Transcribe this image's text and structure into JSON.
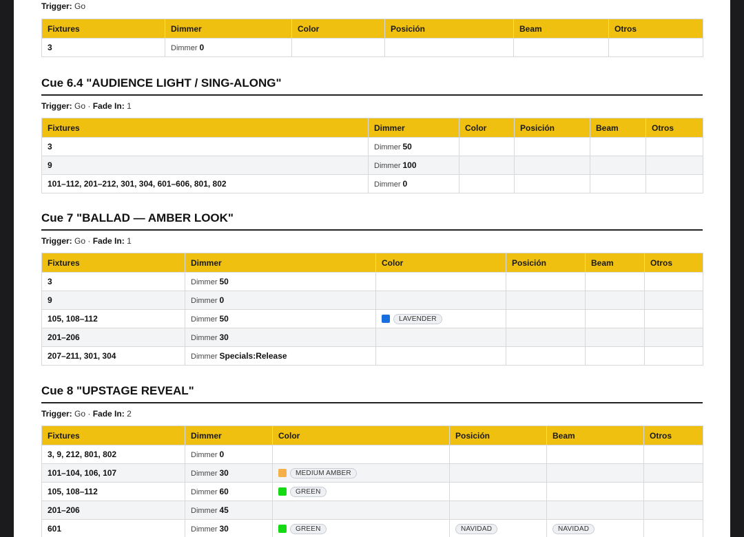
{
  "top": {
    "trigger_label": "Trigger:",
    "trigger_value": "Go",
    "headers": [
      "Fixtures",
      "Dimmer",
      "Color",
      "Posición",
      "Beam",
      "Otros"
    ],
    "rows": [
      {
        "fixtures": "3",
        "dimmer_label": "Dimmer",
        "dimmer_value": "0"
      }
    ]
  },
  "cues": [
    {
      "title": "Cue 6.4 \"AUDIENCE LIGHT / SING-ALONG\"",
      "trigger_label": "Trigger:",
      "trigger_value": "Go",
      "sep": "·",
      "fade_label": "Fade In:",
      "fade_value": "1",
      "headers": [
        "Fixtures",
        "Dimmer",
        "Color",
        "Posición",
        "Beam",
        "Otros"
      ],
      "rows": [
        {
          "fixtures": "3",
          "dimmer_label": "Dimmer",
          "dimmer_value": "50"
        },
        {
          "fixtures": "9",
          "dimmer_label": "Dimmer",
          "dimmer_value": "100"
        },
        {
          "fixtures": "101–112, 201–212, 301, 304, 601–606, 801, 802",
          "dimmer_label": "Dimmer",
          "dimmer_value": "0"
        }
      ]
    },
    {
      "title": "Cue 7 \"BALLAD — AMBER LOOK\"",
      "trigger_label": "Trigger:",
      "trigger_value": "Go",
      "sep": "·",
      "fade_label": "Fade In:",
      "fade_value": "1",
      "headers": [
        "Fixtures",
        "Dimmer",
        "Color",
        "Posición",
        "Beam",
        "Otros"
      ],
      "rows": [
        {
          "fixtures": "3",
          "dimmer_label": "Dimmer",
          "dimmer_value": "50"
        },
        {
          "fixtures": "9",
          "dimmer_label": "Dimmer",
          "dimmer_value": "0"
        },
        {
          "fixtures": "105, 108–112",
          "dimmer_label": "Dimmer",
          "dimmer_value": "50",
          "color_name": "LAVENDER",
          "color_hex": "#1a6fe0"
        },
        {
          "fixtures": "201–206",
          "dimmer_label": "Dimmer",
          "dimmer_value": "30"
        },
        {
          "fixtures": "207–211, 301, 304",
          "dimmer_label": "Dimmer",
          "dimmer_value": "Specials:Release"
        }
      ]
    },
    {
      "title": "Cue 8 \"UPSTAGE REVEAL\"",
      "trigger_label": "Trigger:",
      "trigger_value": "Go",
      "sep": "·",
      "fade_label": "Fade In:",
      "fade_value": "2",
      "headers": [
        "Fixtures",
        "Dimmer",
        "Color",
        "Posición",
        "Beam",
        "Otros"
      ],
      "rows": [
        {
          "fixtures": "3, 9, 212, 801, 802",
          "dimmer_label": "Dimmer",
          "dimmer_value": "0"
        },
        {
          "fixtures": "101–104, 106, 107",
          "dimmer_label": "Dimmer",
          "dimmer_value": "30",
          "color_name": "MEDIUM AMBER",
          "color_hex": "#f5b04a"
        },
        {
          "fixtures": "105, 108–112",
          "dimmer_label": "Dimmer",
          "dimmer_value": "60",
          "color_name": "GREEN",
          "color_hex": "#16d916"
        },
        {
          "fixtures": "201–206",
          "dimmer_label": "Dimmer",
          "dimmer_value": "45"
        },
        {
          "fixtures": "601",
          "dimmer_label": "Dimmer",
          "dimmer_value": "30",
          "color_name": "GREEN",
          "color_hex": "#16d916",
          "position": "NAVIDAD",
          "beam": "NAVIDAD"
        }
      ]
    }
  ],
  "colors": {
    "header_bg": "#f0c010",
    "page_bg": "#1b1b1d",
    "sheet_bg": "#ffffff"
  }
}
